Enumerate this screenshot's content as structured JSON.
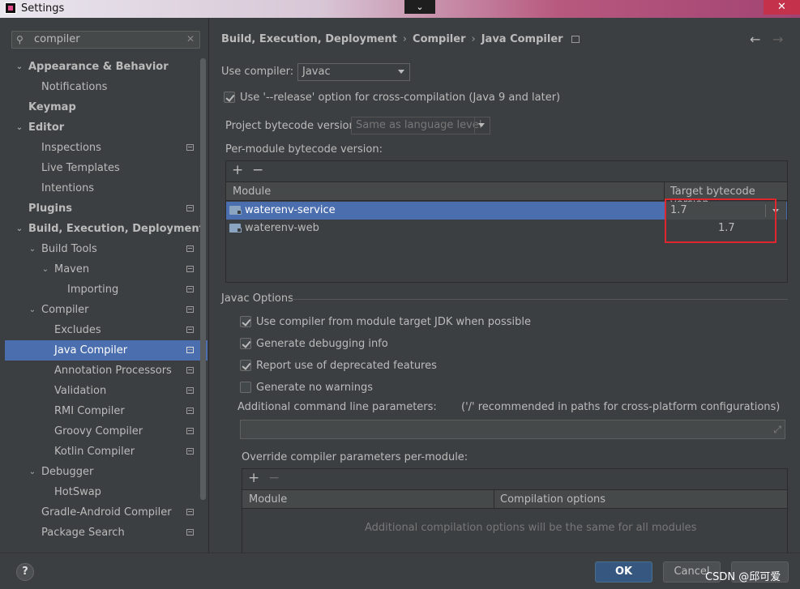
{
  "window": {
    "title": "Settings"
  },
  "search": {
    "value": "compiler"
  },
  "sidebar": {
    "items": [
      {
        "label": "Appearance & Behavior"
      },
      {
        "label": "Notifications"
      },
      {
        "label": "Keymap"
      },
      {
        "label": "Editor"
      },
      {
        "label": "Inspections"
      },
      {
        "label": "Live Templates"
      },
      {
        "label": "Intentions"
      },
      {
        "label": "Plugins"
      },
      {
        "label": "Build, Execution, Deployment"
      },
      {
        "label": "Build Tools"
      },
      {
        "label": "Maven"
      },
      {
        "label": "Importing"
      },
      {
        "label": "Compiler"
      },
      {
        "label": "Excludes"
      },
      {
        "label": "Java Compiler"
      },
      {
        "label": "Annotation Processors"
      },
      {
        "label": "Validation"
      },
      {
        "label": "RMI Compiler"
      },
      {
        "label": "Groovy Compiler"
      },
      {
        "label": "Kotlin Compiler"
      },
      {
        "label": "Debugger"
      },
      {
        "label": "HotSwap"
      },
      {
        "label": "Gradle-Android Compiler"
      },
      {
        "label": "Package Search"
      }
    ]
  },
  "breadcrumb": {
    "part1": "Build, Execution, Deployment",
    "part2": "Compiler",
    "part3": "Java Compiler",
    "sep": "›"
  },
  "main": {
    "use_compiler_label": "Use compiler:",
    "use_compiler_value": "Javac",
    "release_option_label": "Use '--release' option for cross-compilation (Java 9 and later)",
    "project_bytecode_label": "Project bytecode version:",
    "project_bytecode_value": "Same as language level",
    "per_module_label": "Per-module bytecode version:",
    "module_table": {
      "col_module": "Module",
      "col_target": "Target bytecode version",
      "rows": [
        {
          "module": "waterenv-service",
          "target": "1.7"
        },
        {
          "module": "waterenv-web",
          "target": "1.7"
        }
      ]
    },
    "javac_options_title": "Javac Options",
    "options": [
      {
        "label": "Use compiler from module target JDK when possible",
        "checked": true
      },
      {
        "label": "Generate debugging info",
        "checked": true
      },
      {
        "label": "Report use of deprecated features",
        "checked": true
      },
      {
        "label": "Generate no warnings",
        "checked": false
      }
    ],
    "additional_params_label": "Additional command line parameters:",
    "additional_params_hint": "('/' recommended in paths for cross-platform configurations)",
    "override_label": "Override compiler parameters per-module:",
    "override_table": {
      "col_module": "Module",
      "col_options": "Compilation options",
      "empty_text": "Additional compilation options will be the same for all modules"
    }
  },
  "footer": {
    "help": "?",
    "ok": "OK",
    "cancel": "Cancel",
    "watermark": "CSDN @邱可爱"
  }
}
